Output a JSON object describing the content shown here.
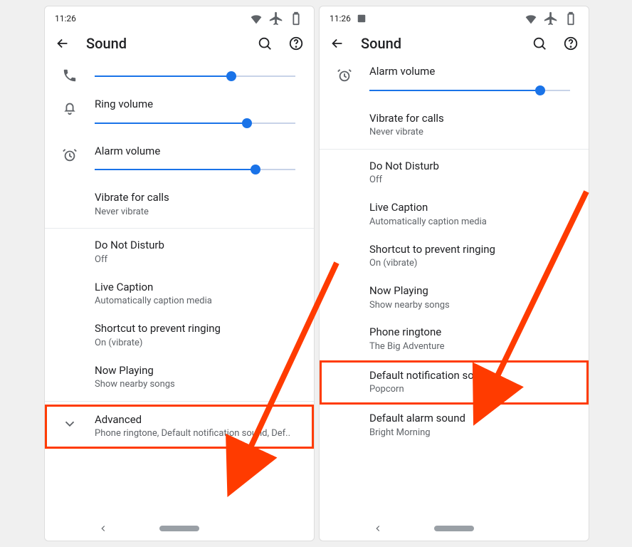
{
  "left": {
    "status": {
      "time": "11:26"
    },
    "header": {
      "title": "Sound"
    },
    "sliders": {
      "call": {
        "label": "",
        "value": 68
      },
      "ring": {
        "label": "Ring volume",
        "value": 76
      },
      "alarm": {
        "label": "Alarm volume",
        "value": 80
      }
    },
    "items": {
      "vibrate": {
        "title": "Vibrate for calls",
        "sub": "Never vibrate"
      },
      "dnd": {
        "title": "Do Not Disturb",
        "sub": "Off"
      },
      "caption": {
        "title": "Live Caption",
        "sub": "Automatically caption media"
      },
      "shortcut": {
        "title": "Shortcut to prevent ringing",
        "sub": "On (vibrate)"
      },
      "nowplaying": {
        "title": "Now Playing",
        "sub": "Show nearby songs"
      },
      "advanced": {
        "title": "Advanced",
        "sub": "Phone ringtone, Default notification sound, Def.."
      }
    }
  },
  "right": {
    "status": {
      "time": "11:26"
    },
    "header": {
      "title": "Sound"
    },
    "sliders": {
      "alarm": {
        "label": "Alarm volume",
        "value": 85
      }
    },
    "items": {
      "vibrate": {
        "title": "Vibrate for calls",
        "sub": "Never vibrate"
      },
      "dnd": {
        "title": "Do Not Disturb",
        "sub": "Off"
      },
      "caption": {
        "title": "Live Caption",
        "sub": "Automatically caption media"
      },
      "shortcut": {
        "title": "Shortcut to prevent ringing",
        "sub": "On (vibrate)"
      },
      "nowplaying": {
        "title": "Now Playing",
        "sub": "Show nearby songs"
      },
      "ringtone": {
        "title": "Phone ringtone",
        "sub": "The Big Adventure"
      },
      "notifsound": {
        "title": "Default notification sound",
        "sub": "Popcorn"
      },
      "alarmsound": {
        "title": "Default alarm sound",
        "sub": "Bright Morning"
      }
    }
  },
  "annotation": {
    "color": "#ff3b00"
  }
}
